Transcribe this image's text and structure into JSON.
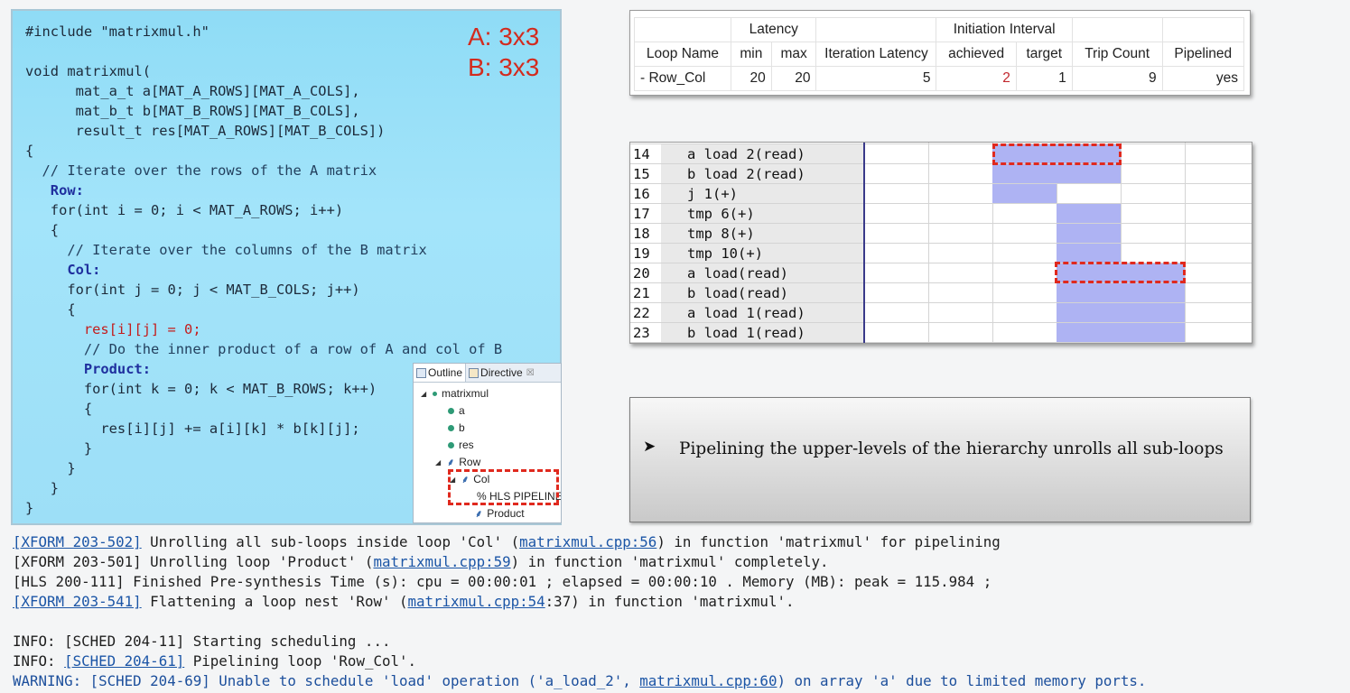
{
  "code": {
    "lines": [
      {
        "text": "#include \"matrixmul.h\"",
        "style": "plain"
      },
      {
        "text": "",
        "style": "plain"
      },
      {
        "text": "void matrixmul(",
        "style": "plain"
      },
      {
        "text": "      mat_a_t a[MAT_A_ROWS][MAT_A_COLS],",
        "style": "plain"
      },
      {
        "text": "      mat_b_t b[MAT_B_ROWS][MAT_B_COLS],",
        "style": "plain"
      },
      {
        "text": "      result_t res[MAT_A_ROWS][MAT_B_COLS])",
        "style": "plain"
      },
      {
        "text": "{",
        "style": "plain"
      },
      {
        "text": "  // Iterate over the rows of the A matrix",
        "style": "comment"
      },
      {
        "text": "   Row:",
        "style": "blue"
      },
      {
        "text": "   for(int i = 0; i < MAT_A_ROWS; i++)",
        "style": "plain"
      },
      {
        "text": "   {",
        "style": "plain"
      },
      {
        "text": "     // Iterate over the columns of the B matrix",
        "style": "comment"
      },
      {
        "text": "     Col:",
        "style": "blue"
      },
      {
        "text": "     for(int j = 0; j < MAT_B_COLS; j++)",
        "style": "plain"
      },
      {
        "text": "     {",
        "style": "plain"
      },
      {
        "text": "       res[i][j] = 0;",
        "style": "red"
      },
      {
        "text": "       // Do the inner product of a row of A and col of B",
        "style": "comment"
      },
      {
        "text": "       Product:",
        "style": "blue"
      },
      {
        "text": "       for(int k = 0; k < MAT_B_ROWS; k++)",
        "style": "plain"
      },
      {
        "text": "       {",
        "style": "plain"
      },
      {
        "text": "         res[i][j] += a[i][k] * b[k][j];",
        "style": "plain"
      },
      {
        "text": "       }",
        "style": "plain"
      },
      {
        "text": "     }",
        "style": "plain"
      },
      {
        "text": "   }",
        "style": "plain"
      },
      {
        "text": "}",
        "style": "plain"
      }
    ],
    "dims_a": "A: 3x3",
    "dims_b": "B: 3x3"
  },
  "outline": {
    "tab_outline": "Outline",
    "tab_directive": "Directive",
    "tab_close": "☒",
    "root": "matrixmul",
    "items": [
      "a",
      "b",
      "res"
    ],
    "row": "Row",
    "col": "Col",
    "pipeline": "% HLS PIPELINE",
    "product": "Product"
  },
  "latency_table": {
    "group_latency": "Latency",
    "group_ii": "Initiation Interval",
    "headers": [
      "Loop Name",
      "min",
      "max",
      "Iteration Latency",
      "achieved",
      "target",
      "Trip Count",
      "Pipelined"
    ],
    "row": [
      "- Row_Col",
      "20",
      "20",
      "5",
      "2",
      "1",
      "9",
      "yes"
    ]
  },
  "schedule": {
    "rows": [
      {
        "num": "14",
        "op": "a load 2(read)"
      },
      {
        "num": "15",
        "op": "b load 2(read)"
      },
      {
        "num": "16",
        "op": "j 1(+)"
      },
      {
        "num": "17",
        "op": "tmp 6(+)"
      },
      {
        "num": "18",
        "op": "tmp 8(+)"
      },
      {
        "num": "19",
        "op": "tmp 10(+)"
      },
      {
        "num": "20",
        "op": "a load(read)"
      },
      {
        "num": "21",
        "op": "b load(read)"
      },
      {
        "num": "22",
        "op": "a load 1(read)"
      },
      {
        "num": "23",
        "op": "b load 1(read)"
      }
    ]
  },
  "note": {
    "bullet": "➤",
    "text": "Pipelining the upper-levels of the hierarchy unrolls all sub-loops"
  },
  "console": {
    "l1_link": "[XFORM 203-502]",
    "l1_a": " Unrolling all sub-loops inside loop 'Col' (",
    "l1_file": "matrixmul.cpp:56",
    "l1_b": ") in function 'matrixmul' for pipelining",
    "l2_a": "[XFORM 203-501] Unrolling loop 'Product' (",
    "l2_file": "matrixmul.cpp:59",
    "l2_b": ") in function 'matrixmul' completely.",
    "l3": "[HLS 200-111] Finished Pre-synthesis Time (s): cpu = 00:00:01 ; elapsed = 00:00:10 . Memory (MB): peak = 115.984 ;",
    "l4_link": "[XFORM 203-541]",
    "l4_a": " Flattening a loop nest 'Row' (",
    "l4_file": "matrixmul.cpp:54",
    "l4_b": ":37) in function 'matrixmul'.",
    "l5": "INFO: [SCHED 204-11] Starting scheduling ...",
    "l6_a": "INFO: ",
    "l6_link": "[SCHED 204-61]",
    "l6_b": " Pipelining loop 'Row_Col'.",
    "l7_a": "WARNING: [SCHED 204-69] Unable to schedule 'load' operation ('a_load_2', ",
    "l7_file": "matrixmul.cpp:60",
    "l7_b": ") on array 'a' due to limited memory ports."
  }
}
